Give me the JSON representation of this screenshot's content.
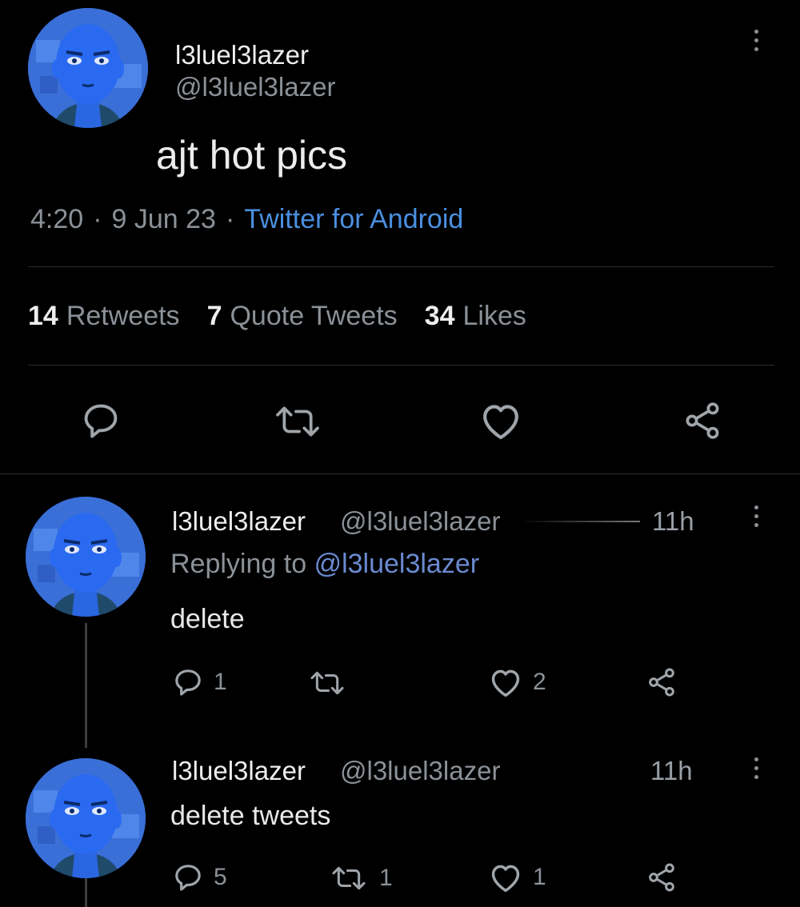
{
  "tweet": {
    "display_name": "l3luel3lazer",
    "handle": "@l3luel3lazer",
    "text": "ajt hot pics",
    "time": "4:20",
    "date": "9 Jun 23",
    "source": "Twitter for Android",
    "stats": {
      "retweets_count": "14",
      "retweets_label": "Retweets",
      "quotes_count": "7",
      "quotes_label": "Quote Tweets",
      "likes_count": "34",
      "likes_label": "Likes"
    }
  },
  "replies": [
    {
      "display_name": "l3luel3lazer",
      "handle": "@l3luel3lazer",
      "time": "11h",
      "replying_prefix": "Replying to",
      "replying_to": "@l3luel3lazer",
      "text": "delete",
      "reply_count": "1",
      "retweet_count": "",
      "like_count": "2"
    },
    {
      "display_name": "l3luel3lazer",
      "handle": "@l3luel3lazer",
      "time": "11h",
      "text": "delete tweets",
      "reply_count": "5",
      "retweet_count": "1",
      "like_count": "1"
    }
  ],
  "separator": "·",
  "colors": {
    "background": "#000000",
    "text": "#e7e9ea",
    "secondary": "#8b9197",
    "link": "#4a8fe0",
    "avatar": "#3a6fd8"
  }
}
